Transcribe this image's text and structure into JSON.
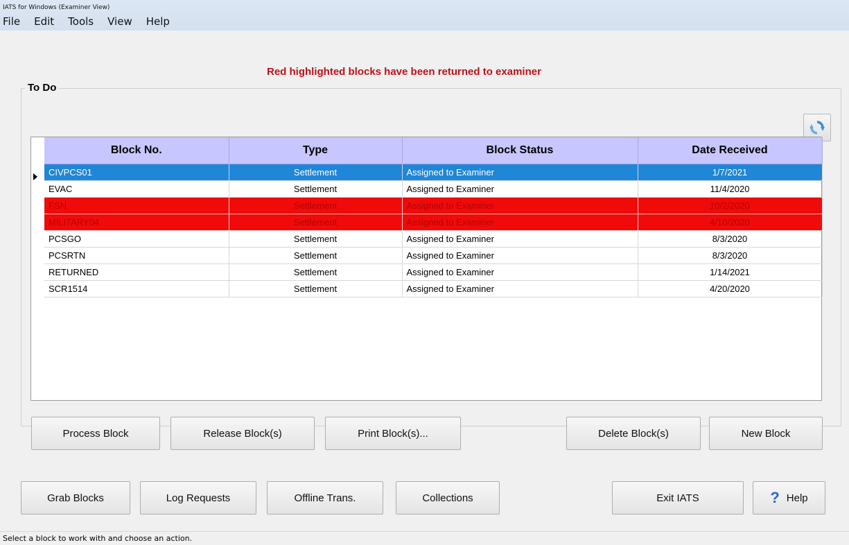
{
  "window": {
    "title": "IATS for Windows (Examiner View)"
  },
  "menu": [
    "File",
    "Edit",
    "Tools",
    "View",
    "Help"
  ],
  "notice": "Red highlighted blocks have been returned to examiner",
  "group_label": "To Do",
  "refresh_icon": "refresh-icon",
  "table": {
    "columns": [
      "Block No.",
      "Type",
      "Block Status",
      "Date Received"
    ],
    "rows": [
      {
        "block": "CIVPCS01",
        "type": "Settlement",
        "status": "Assigned to Examiner",
        "date": "1/7/2021",
        "state": "selected"
      },
      {
        "block": "EVAC",
        "type": "Settlement",
        "status": "Assigned to Examiner",
        "date": "11/4/2020",
        "state": "normal"
      },
      {
        "block": "FSN",
        "type": "Settlement",
        "status": "Assigned to Examiner",
        "date": "10/2/2020",
        "state": "returned"
      },
      {
        "block": "MILITARY04",
        "type": "Settlement",
        "status": "Assigned to Examiner",
        "date": "4/10/2020",
        "state": "returned"
      },
      {
        "block": "PCSGO",
        "type": "Settlement",
        "status": "Assigned to Examiner",
        "date": "8/3/2020",
        "state": "normal"
      },
      {
        "block": "PCSRTN",
        "type": "Settlement",
        "status": "Assigned to Examiner",
        "date": "8/3/2020",
        "state": "normal"
      },
      {
        "block": "RETURNED",
        "type": "Settlement",
        "status": "Assigned to Examiner",
        "date": "1/14/2021",
        "state": "normal"
      },
      {
        "block": "SCR1514",
        "type": "Settlement",
        "status": "Assigned to Examiner",
        "date": "4/20/2020",
        "state": "normal"
      }
    ]
  },
  "block_buttons": {
    "process": "Process Block",
    "release": "Release Block(s)",
    "print": "Print Block(s)...",
    "delete": "Delete Block(s)",
    "new": "New Block"
  },
  "bottom_buttons": {
    "grab": "Grab Blocks",
    "log": "Log Requests",
    "offline": "Offline Trans.",
    "collections": "Collections",
    "exit": "Exit IATS",
    "help": "Help"
  },
  "colors": {
    "header": "#c8c6ff",
    "selected": "#1f86d8",
    "returned": "#f10a0a",
    "notice": "#c0101a"
  },
  "status_bar": "Select a block to work with and choose an action."
}
